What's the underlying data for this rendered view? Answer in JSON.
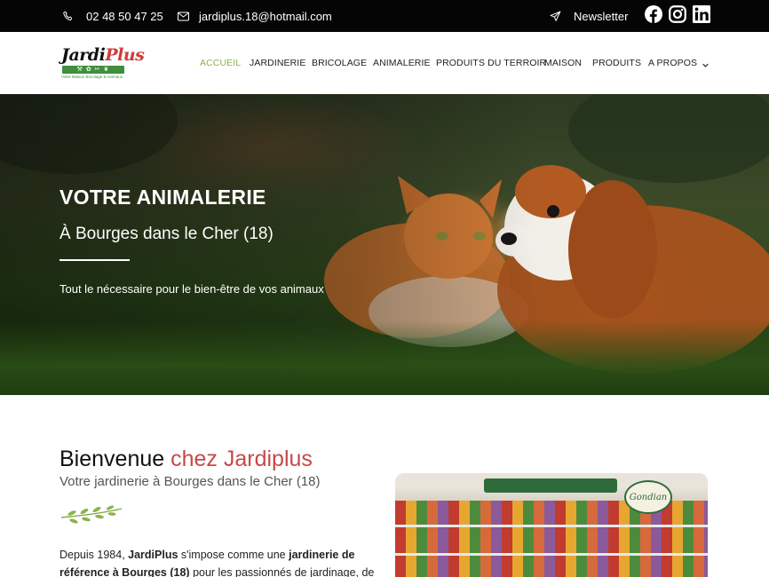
{
  "topbar": {
    "phone": "02 48 50 47 25",
    "email": "jardiplus.18@hotmail.com",
    "newsletter": "Newsletter",
    "social": [
      "facebook-icon",
      "instagram-icon",
      "linkedin-icon"
    ]
  },
  "logo": {
    "name_part1": "Jardi",
    "name_part2": "Plus",
    "tagline": "Votre Maison Bricolage & Animaux"
  },
  "nav": {
    "items": [
      "ACCUEIL",
      "JARDINERIE",
      "BRICOLAGE",
      "ANIMALERIE",
      "PRODUITS DU TERROIR",
      "MAISON",
      "PRODUITS",
      "A PROPOS"
    ],
    "active_index": 0
  },
  "hero": {
    "title": "VOTRE ANIMALERIE",
    "subtitle": "À Bourges dans le Cher (18)",
    "text": "Tout le nécessaire pour le bien-être de vos animaux"
  },
  "welcome": {
    "title_plain": "Bienvenue",
    "title_accent": "chez Jardiplus",
    "subtitle": "Votre jardinerie à Bourges dans le Cher (18)",
    "para_1": "Depuis 1984, ",
    "para_brand": "JardiPlus",
    "para_2": " s'impose comme une ",
    "para_strong": "jardinerie de référence à Bourges (18)",
    "para_3": " pour les passionnés de jardinage, de"
  },
  "photo": {
    "sign_text": "Gondian"
  },
  "colors": {
    "topbar_bg": "#050505",
    "nav_active": "#8bb34b",
    "accent_red": "#c8484a",
    "logo_green": "#3e8e3e"
  }
}
